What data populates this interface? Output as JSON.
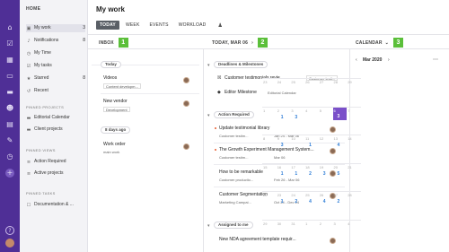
{
  "rail_icons": [
    "home-icon",
    "check-icon",
    "calendar-icon",
    "chat-icon",
    "folder-icon",
    "people-icon",
    "grid-icon",
    "settings-icon",
    "clock-icon",
    "add-icon",
    "help-icon",
    "user-avatar-icon"
  ],
  "sidebar": {
    "heading": "HOME",
    "items": [
      {
        "label": "My work",
        "count": "3",
        "active": true
      },
      {
        "label": "Notifications",
        "count": "8"
      },
      {
        "label": "My Time",
        "count": ""
      },
      {
        "label": "My tasks",
        "count": ""
      },
      {
        "label": "Starred",
        "count": "8"
      },
      {
        "label": "Recent",
        "count": ""
      }
    ],
    "pinned_projects_heading": "PINNED PROJECTS",
    "pinned_projects": [
      "Editorial Calendar",
      "Client projects"
    ],
    "pinned_views_heading": "PINNED VIEWS",
    "pinned_views": [
      "Action Required",
      "Active projects"
    ],
    "pinned_tasks_heading": "PINNED TASKS",
    "pinned_tasks": [
      "Documentation & ..."
    ]
  },
  "main": {
    "title": "My work",
    "tabs": [
      "TODAY",
      "WEEK",
      "EVENTS",
      "WORKLOAD"
    ]
  },
  "inbox": {
    "header": "INBOX",
    "badge": "1",
    "groups": [
      {
        "label": "Today",
        "items": [
          {
            "title": "Videos",
            "tag": "Content developm..."
          },
          {
            "title": "New vendor",
            "tag": "Development"
          }
        ]
      },
      {
        "label": "8 days ago",
        "items": [
          {
            "title": "Work order",
            "tag": "main work"
          }
        ]
      }
    ]
  },
  "today": {
    "header": "TODAY, MAR 06",
    "badge": "2",
    "deadlines_label": "Deadlines & Milestones",
    "deadlines": [
      {
        "title": "Customer testimonials revie...",
        "tag": "Customer testi..."
      },
      {
        "title": "Editor Milestone",
        "tag": "Editorial Calendar"
      }
    ],
    "action_label": "Action Required",
    "actions": [
      {
        "title": "Update testimonial library",
        "tag": "Customer testim...",
        "date": "Jan 24 - Mar 06"
      },
      {
        "title": "The Growth Experiment Management System...",
        "tag": "Customer testim...",
        "date": "Mar 06"
      },
      {
        "title": "How to be remarkable",
        "tag": "Customer productio...",
        "date": "Feb 26 - Mar 06"
      },
      {
        "title": "Customer Segmentation",
        "tag": "Marketing Campai...",
        "date": "Oct 24 - Dec 24"
      }
    ],
    "assigned_label": "Assigned to me",
    "assigned": [
      {
        "title": "New NDA agreement template requir..."
      }
    ]
  },
  "calendar": {
    "header": "CALENDAR",
    "badge": "3",
    "month": "Mar 2020",
    "rows": [
      [
        {
          "n": "23"
        },
        {
          "n": "24"
        },
        {
          "n": "25"
        },
        {
          "n": "26"
        },
        {
          "n": "27"
        },
        {
          "n": "28"
        },
        {
          "n": "29"
        }
      ],
      [
        {
          "n": "1"
        },
        {
          "n": "2",
          "c": "1"
        },
        {
          "n": "3",
          "c": "3"
        },
        {
          "n": "4"
        },
        {
          "n": "5"
        },
        {
          "n": "6",
          "c": "3",
          "today": true
        },
        {
          "n": "7"
        }
      ],
      [
        {
          "n": "8"
        },
        {
          "n": "9",
          "c": "3"
        },
        {
          "n": "10"
        },
        {
          "n": "11",
          "c": "1"
        },
        {
          "n": "12"
        },
        {
          "n": "13",
          "c": "4"
        },
        {
          "n": "14"
        }
      ],
      [
        {
          "n": "15"
        },
        {
          "n": "16",
          "c": "1"
        },
        {
          "n": "17",
          "c": "1"
        },
        {
          "n": "18",
          "c": "2"
        },
        {
          "n": "19",
          "c": "3"
        },
        {
          "n": "20",
          "c": "5"
        },
        {
          "n": "21"
        }
      ],
      [
        {
          "n": "22"
        },
        {
          "n": "23",
          "c": "1"
        },
        {
          "n": "24",
          "c": "2"
        },
        {
          "n": "25",
          "c": "4"
        },
        {
          "n": "26",
          "c": "4"
        },
        {
          "n": "27",
          "c": "2"
        },
        {
          "n": "28"
        }
      ],
      [
        {
          "n": "29"
        },
        {
          "n": "30"
        },
        {
          "n": "31"
        },
        {
          "n": "1"
        },
        {
          "n": "2"
        },
        {
          "n": "3"
        },
        {
          "n": "4"
        }
      ]
    ]
  }
}
